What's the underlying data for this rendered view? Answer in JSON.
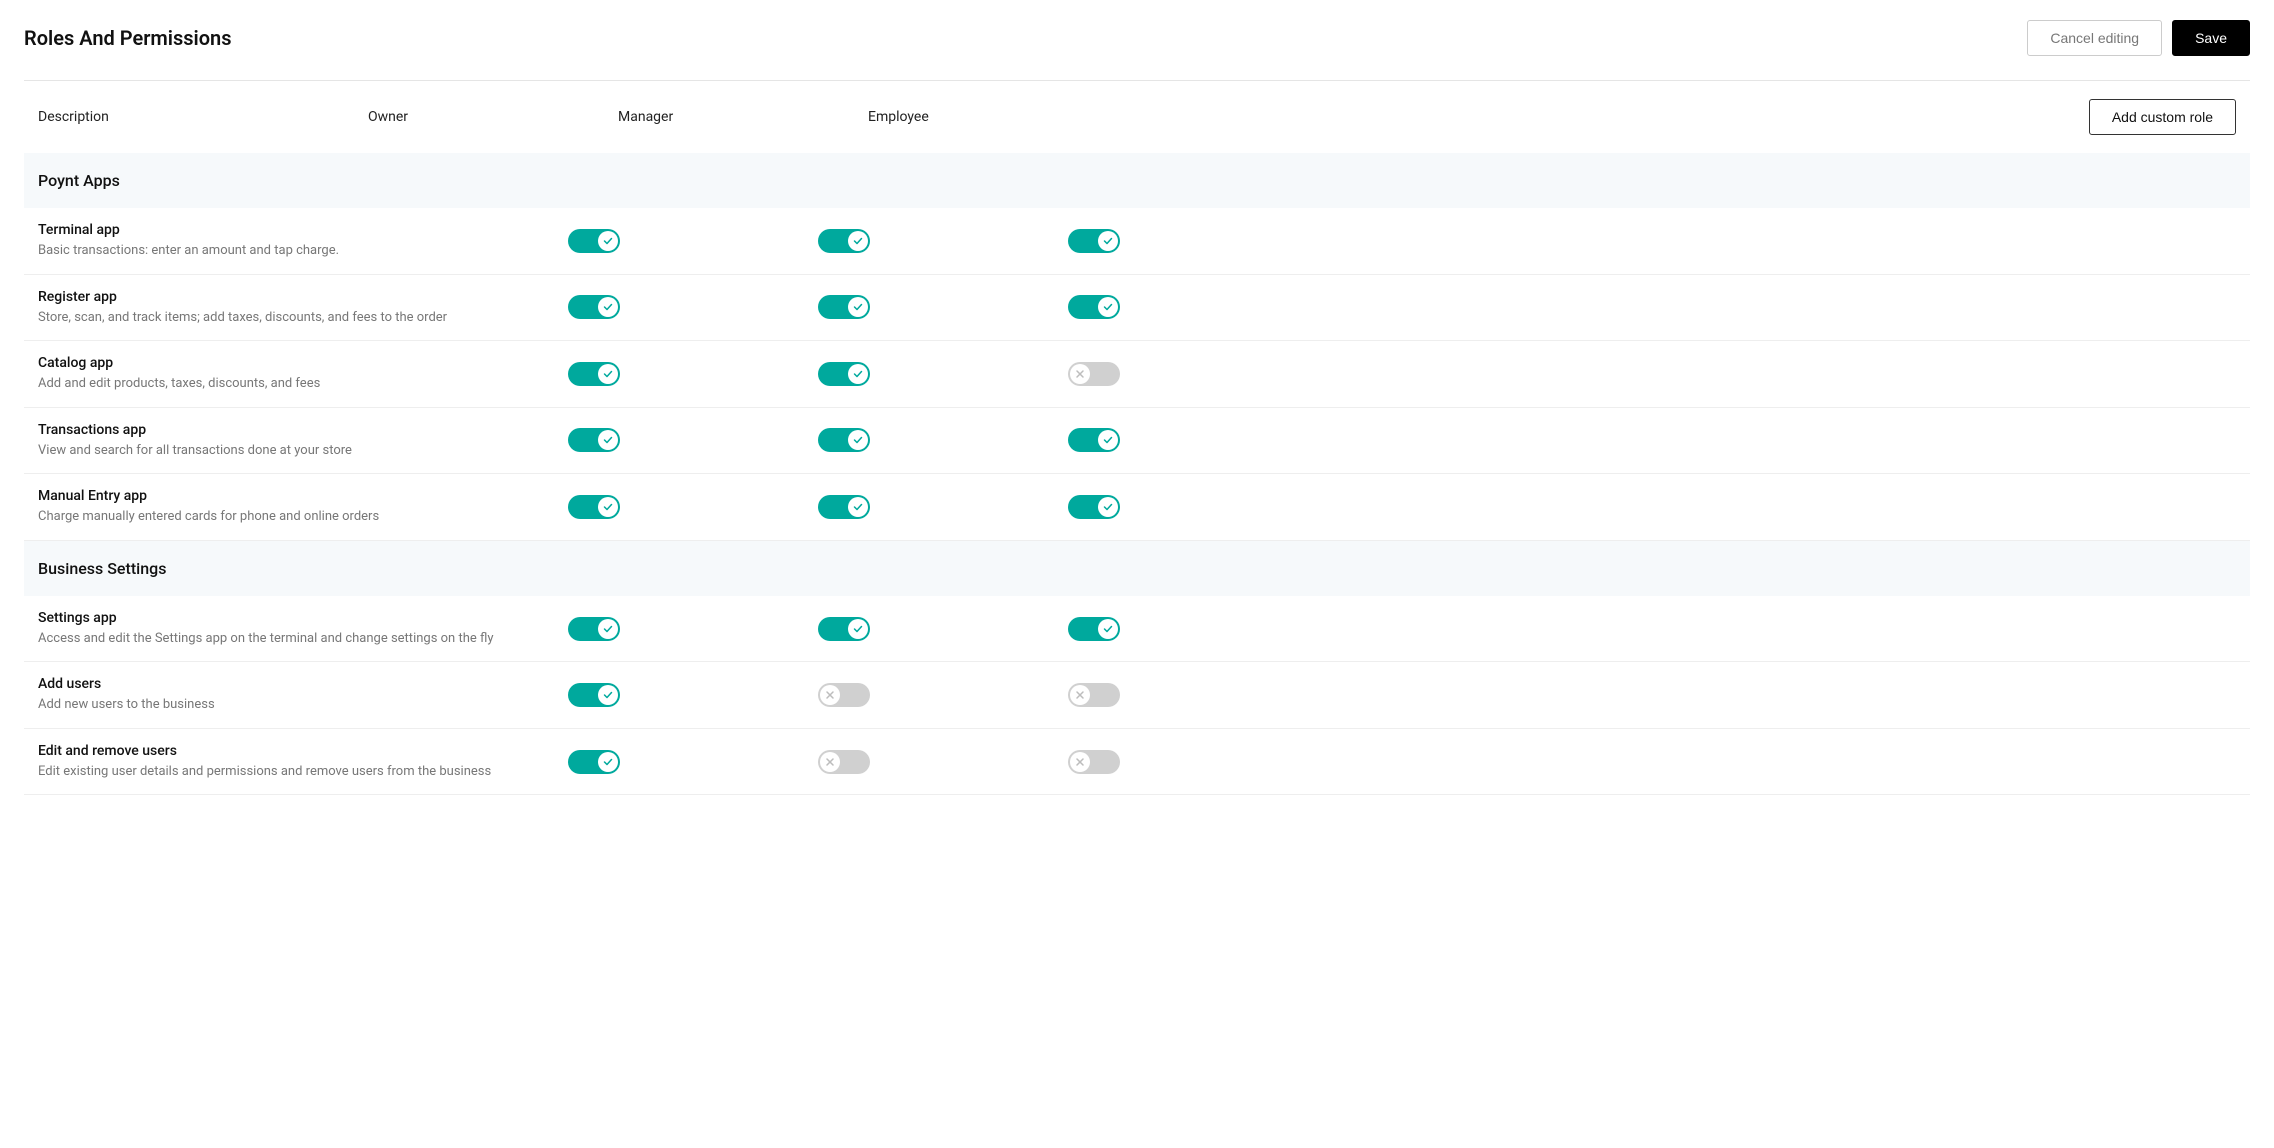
{
  "page": {
    "title": "Roles And Permissions"
  },
  "header_buttons": {
    "cancel": "Cancel editing",
    "save": "Save"
  },
  "columns": {
    "description": "Description",
    "roles": [
      "Owner",
      "Manager",
      "Employee"
    ],
    "add_custom_role": "Add custom role"
  },
  "sections": [
    {
      "title": "Poynt Apps",
      "permissions": [
        {
          "name": "Terminal app",
          "description": "Basic transactions: enter an amount and tap charge.",
          "values": [
            true,
            true,
            true
          ]
        },
        {
          "name": "Register app",
          "description": "Store, scan, and track items; add taxes, discounts, and fees to the order",
          "values": [
            true,
            true,
            true
          ]
        },
        {
          "name": "Catalog app",
          "description": "Add and edit products, taxes, discounts, and fees",
          "values": [
            true,
            true,
            false
          ]
        },
        {
          "name": "Transactions app",
          "description": "View and search for all transactions done at your store",
          "values": [
            true,
            true,
            true
          ]
        },
        {
          "name": "Manual Entry app",
          "description": "Charge manually entered cards for phone and online orders",
          "values": [
            true,
            true,
            true
          ]
        }
      ]
    },
    {
      "title": "Business Settings",
      "permissions": [
        {
          "name": "Settings app",
          "description": "Access and edit the Settings app on the terminal and change settings on the fly",
          "values": [
            true,
            true,
            true
          ]
        },
        {
          "name": "Add users",
          "description": "Add new users to the business",
          "values": [
            true,
            false,
            false
          ]
        },
        {
          "name": "Edit and remove users",
          "description": "Edit existing user details and permissions and remove users from the business",
          "values": [
            true,
            false,
            false
          ]
        }
      ]
    }
  ]
}
